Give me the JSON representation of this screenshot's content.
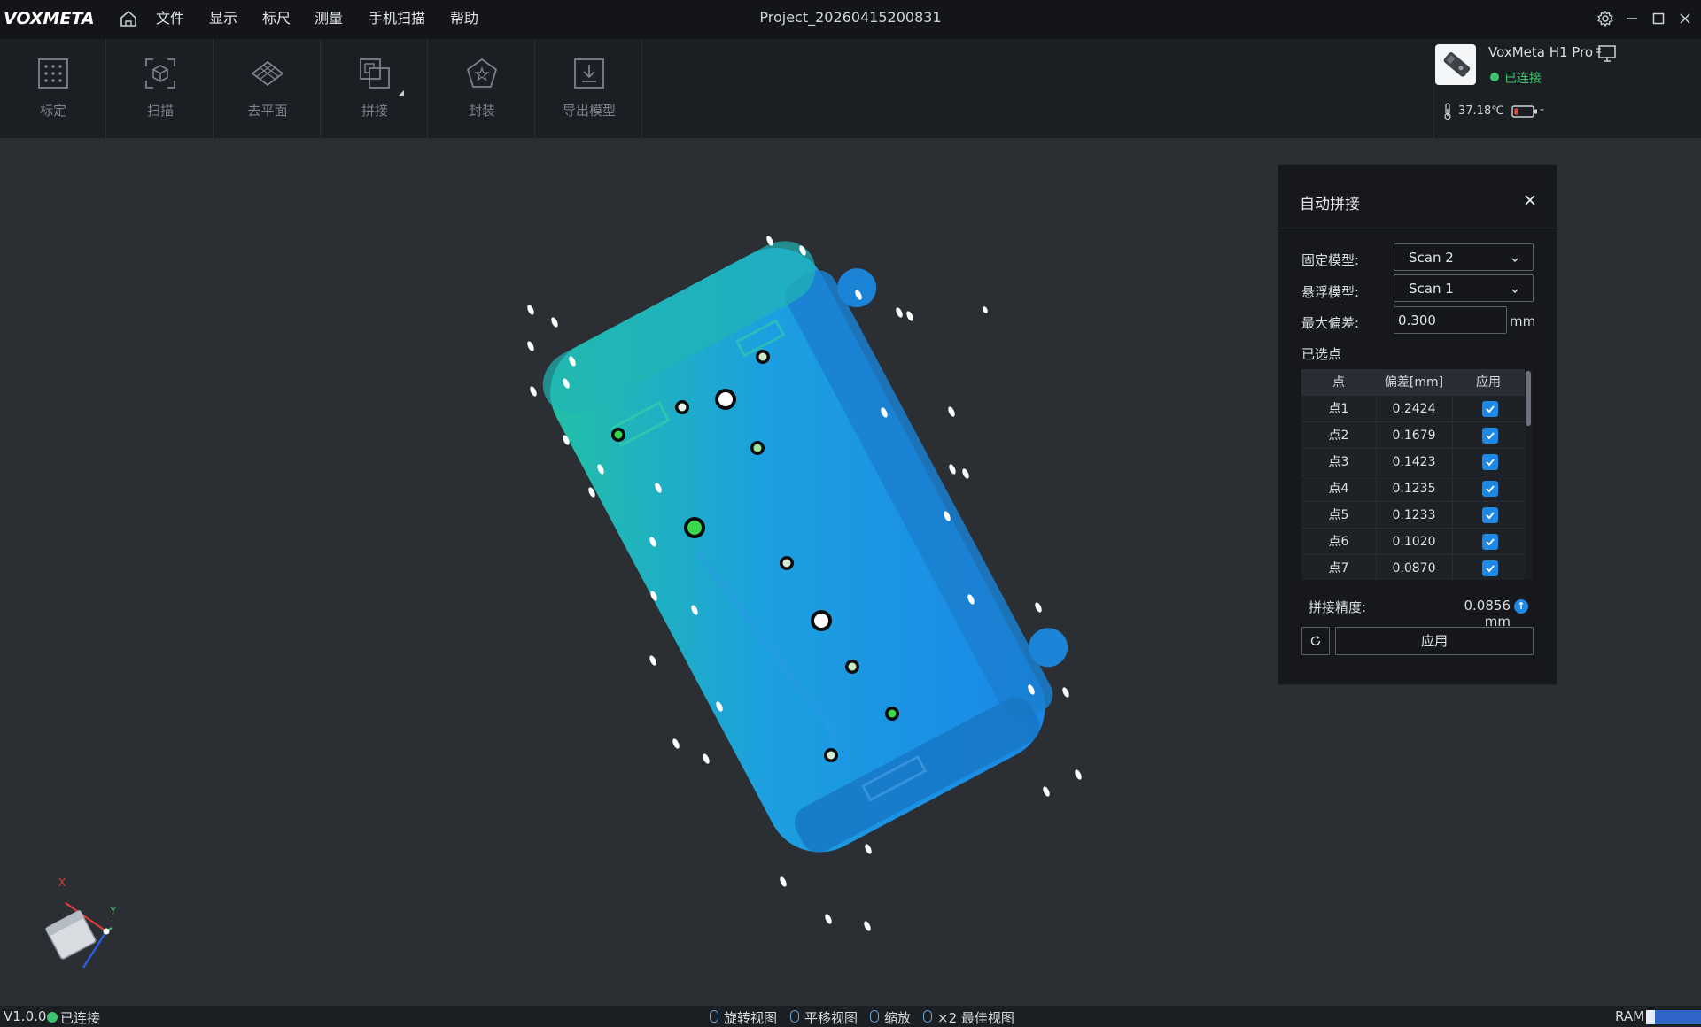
{
  "app": {
    "logo_text": "VOXMETA",
    "project_title": "Project_20260415200831"
  },
  "menu": {
    "items": [
      "文件",
      "显示",
      "标尺",
      "测量",
      "手机扫描",
      "帮助"
    ]
  },
  "toolbar": {
    "tools": [
      {
        "label": "标定",
        "icon": "calibrate-grid-icon"
      },
      {
        "label": "扫描",
        "icon": "scan-cube-icon"
      },
      {
        "label": "去平面",
        "icon": "remove-plane-icon"
      },
      {
        "label": "拼接",
        "icon": "stitch-icon"
      },
      {
        "label": "封装",
        "icon": "mesh-pentagon-icon"
      },
      {
        "label": "导出模型",
        "icon": "export-download-icon"
      }
    ]
  },
  "device": {
    "name": "VoxMeta H1 Pro",
    "status": "已连接",
    "temperature": "37.18℃",
    "battery_text": "-"
  },
  "panel": {
    "title": "自动拼接",
    "fixed_model_label": "固定模型:",
    "fixed_model_value": "Scan 2",
    "floating_model_label": "悬浮模型:",
    "floating_model_value": "Scan 1",
    "max_deviation_label": "最大偏差:",
    "max_deviation_value": "0.300",
    "unit": "mm",
    "selected_points_label": "已选点",
    "columns": [
      "点",
      "偏差[mm]",
      "应用"
    ],
    "rows": [
      {
        "point": "点1",
        "deviation": "0.2424",
        "applied": true
      },
      {
        "point": "点2",
        "deviation": "0.1679",
        "applied": true
      },
      {
        "point": "点3",
        "deviation": "0.1423",
        "applied": true
      },
      {
        "point": "点4",
        "deviation": "0.1235",
        "applied": true
      },
      {
        "point": "点5",
        "deviation": "0.1233",
        "applied": true
      },
      {
        "point": "点6",
        "deviation": "0.1020",
        "applied": true
      },
      {
        "point": "点7",
        "deviation": "0.0870",
        "applied": true
      }
    ],
    "accuracy_label": "拼接精度:",
    "accuracy_value": "0.0856 mm",
    "apply_label": "应用"
  },
  "status": {
    "version": "V1.0.0",
    "connection": "已连接",
    "hints": [
      "旋转视图",
      "平移视图",
      "缩放",
      "×2 最佳视图"
    ],
    "ram_label": "RAM"
  },
  "axis_labels": {
    "x": "X",
    "y": "Y"
  },
  "colors": {
    "accent_blue": "#1e88e5",
    "connected_green": "#3ec46d",
    "model_blue": "#1a8fe3",
    "model_teal": "#1fb39b",
    "marker_green": "#39d84a"
  }
}
